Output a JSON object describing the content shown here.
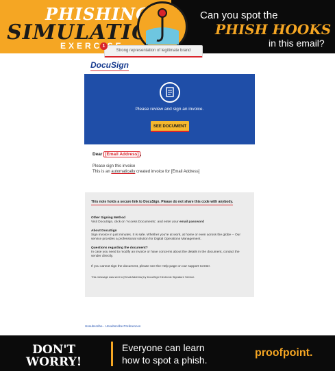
{
  "banner": {
    "title_line1": "PHISHING",
    "title_line2": "SIMULATION",
    "title_line3": "EXERCISE",
    "right_line1": "Can you spot the",
    "right_line2": "PHISH HOOKS",
    "right_line3": "in this email?"
  },
  "annotation": {
    "number": "1",
    "text": "Strong representation of legitimate brand"
  },
  "email": {
    "brand_logo": "DocuSign",
    "hero_text": "Please review and sign an invoice.",
    "button_label": "SEE DOCUMENT",
    "greeting_prefix": "Dear",
    "greeting_address": "[Email Address]",
    "greeting_suffix": ",",
    "line1": "Please sign this invoice",
    "line2_before": "This is an",
    "line2_highlight": "automatically",
    "line2_after": "created invoice for [Email Address]"
  },
  "infobox": {
    "warning": "This note holds a secure link to DocuSign. Please do not share this code with anybody.",
    "other_head": "Other Signing Method",
    "other_text": "Visit DocuSign, click on 'Access Documents', and enter your",
    "other_bold": "email password",
    "about_head": "About DocuSign",
    "about_text": "Sign invoice in just minutes. It is safe. Whether you're at work, at home or even across the globe -- Our service provides a professional solution for Digital Operations Management.",
    "questions_head": "Questions regarding the document?",
    "questions_text": "In case you need to modify an invoice or have concerns about the details in the document, contact the sender directly.",
    "help_text": "If you cannot sign the document, please see the Help page on our support Center.",
    "footer_text": "This message was sent to [Email Address] by DocuSign Electronic Signature Service."
  },
  "links": {
    "unsubscribe": "Unsubscribe - Unsubscribe Preferences"
  },
  "footer": {
    "dont": "DON'T",
    "worry": "WORRY!",
    "line1": "Everyone can learn",
    "line2": "how to spot a phish.",
    "brand": "proofpoint."
  },
  "colors": {
    "accent_orange": "#f5a623",
    "docusign_blue": "#1f4ea8",
    "alert_red": "#d9242b"
  }
}
